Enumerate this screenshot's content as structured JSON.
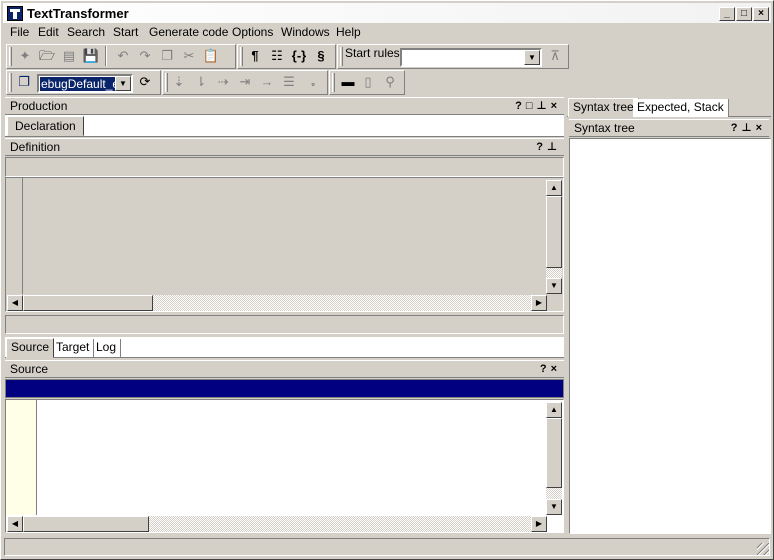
{
  "window": {
    "title": "TextTransformer"
  },
  "menu": {
    "items": [
      "File",
      "Edit",
      "Search",
      "Start",
      "Generate code",
      "Options",
      "Windows",
      "Help"
    ]
  },
  "toolbar": {
    "start_rules_label": "Start rules",
    "start_rules_value": "",
    "debug_combo_value": "ebugDefault_er"
  },
  "production_panel": {
    "title": "Production",
    "tab_label": "Declaration"
  },
  "definition_panel": {
    "title": "Definition"
  },
  "bottom_tabs": {
    "items": [
      "Source",
      "Target",
      "Log"
    ]
  },
  "source_panel": {
    "title": "Source"
  },
  "right_tabs": {
    "items": [
      "Syntax tree",
      "Expected, Stack"
    ]
  },
  "syntax_tree_panel": {
    "title": "Syntax tree"
  },
  "colors": {
    "selection": "#000080",
    "editor_gutter": "#ffffe8",
    "face": "#d4d0c8"
  }
}
